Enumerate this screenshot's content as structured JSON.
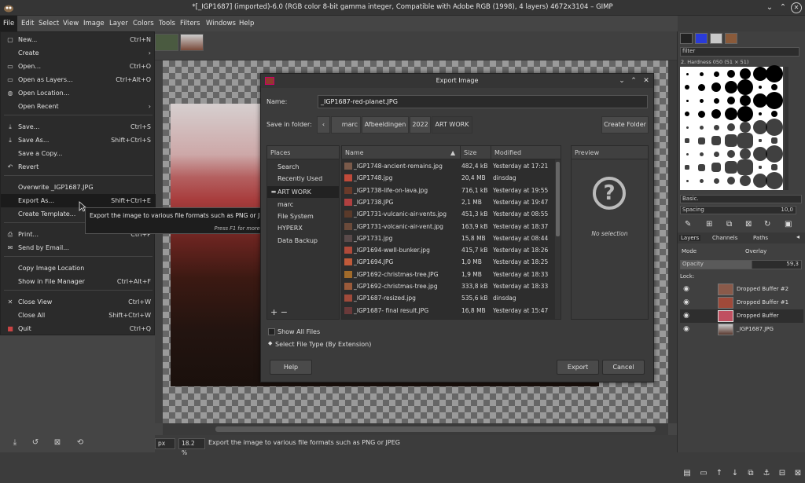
{
  "window": {
    "title": "*[_IGP1687] (imported)-6.0 (RGB color 8-bit gamma integer, Compatible with Adobe RGB (1998), 4 layers) 4672x3104 – GIMP"
  },
  "menubar": [
    "File",
    "Edit",
    "Select",
    "View",
    "Image",
    "Layer",
    "Colors",
    "Tools",
    "Filters",
    "Windows",
    "Help"
  ],
  "file_menu": {
    "new": {
      "label": "New...",
      "shortcut": "Ctrl+N"
    },
    "create": {
      "label": "Create",
      "shortcut": "›"
    },
    "open": {
      "label": "Open...",
      "shortcut": "Ctrl+O"
    },
    "open_layers": {
      "label": "Open as Layers...",
      "shortcut": "Ctrl+Alt+O"
    },
    "open_location": {
      "label": "Open Location...",
      "shortcut": ""
    },
    "open_recent": {
      "label": "Open Recent",
      "shortcut": "›"
    },
    "save": {
      "label": "Save...",
      "shortcut": "Ctrl+S"
    },
    "save_as": {
      "label": "Save As...",
      "shortcut": "Shift+Ctrl+S"
    },
    "save_copy": {
      "label": "Save a Copy...",
      "shortcut": ""
    },
    "revert": {
      "label": "Revert",
      "shortcut": ""
    },
    "overwrite": {
      "label": "Overwrite _IGP1687.JPG",
      "shortcut": ""
    },
    "export_as": {
      "label": "Export As...",
      "shortcut": "Shift+Ctrl+E"
    },
    "create_template": {
      "label": "Create Template...",
      "shortcut": ""
    },
    "print": {
      "label": "Print...",
      "shortcut": "Ctrl+P"
    },
    "send_email": {
      "label": "Send by Email...",
      "shortcut": ""
    },
    "copy_location": {
      "label": "Copy Image Location",
      "shortcut": ""
    },
    "show_manager": {
      "label": "Show in File Manager",
      "shortcut": "Ctrl+Alt+F"
    },
    "close_view": {
      "label": "Close View",
      "shortcut": "Ctrl+W"
    },
    "close_all": {
      "label": "Close All",
      "shortcut": "Shift+Ctrl+W"
    },
    "quit": {
      "label": "Quit",
      "shortcut": "Ctrl+Q"
    }
  },
  "tooltip": {
    "text": "Export the image to various file formats such as PNG or JPEG",
    "help": "Press F1 for more help"
  },
  "status": {
    "unit": "px",
    "zoom": "18.2 %",
    "message": "Export the image to various file formats such as PNG or JPEG"
  },
  "dialog": {
    "title": "Export Image",
    "name_label": "Name:",
    "name_value": "_IGP1687-red-planet.JPG",
    "folder_label": "Save in folder:",
    "breadcrumbs": [
      "marc",
      "Afbeeldingen",
      "2022",
      "ART WORK"
    ],
    "create_folder": "Create Folder",
    "places_header": "Places",
    "places": [
      {
        "icon": "search-icon",
        "label": "Search"
      },
      {
        "icon": "clock-icon",
        "label": "Recently Used"
      },
      {
        "icon": "folder-icon",
        "label": "ART WORK"
      },
      {
        "icon": "home-icon",
        "label": "marc"
      },
      {
        "icon": "drive-icon",
        "label": "File System"
      },
      {
        "icon": "drive-icon",
        "label": "HYPERX"
      },
      {
        "icon": "drive-icon",
        "label": "Data Backup"
      }
    ],
    "columns": {
      "name": "Name",
      "size": "Size",
      "modified": "Modified"
    },
    "files": [
      {
        "name": "_IGP1748-ancient-remains.jpg",
        "size": "482,4 kB",
        "modified": "Yesterday at 17:21"
      },
      {
        "name": "_IGP1748.jpg",
        "size": "20,4 MB",
        "modified": "dinsdag"
      },
      {
        "name": "_IGP1738-life-on-lava.jpg",
        "size": "716,1 kB",
        "modified": "Yesterday at 19:55"
      },
      {
        "name": "_IGP1738.JPG",
        "size": "2,1 MB",
        "modified": "Yesterday at 19:47"
      },
      {
        "name": "_IGP1731-vulcanic-air-vents.jpg",
        "size": "451,3 kB",
        "modified": "Yesterday at 08:55"
      },
      {
        "name": "_IGP1731-volcanic-air-vent.jpg",
        "size": "163,9 kB",
        "modified": "Yesterday at 18:37"
      },
      {
        "name": "_IGP1731.jpg",
        "size": "15,8 MB",
        "modified": "Yesterday at 08:44"
      },
      {
        "name": "_IGP1694-wwII-bunker.jpg",
        "size": "415,7 kB",
        "modified": "Yesterday at 18:26"
      },
      {
        "name": "_IGP1694.JPG",
        "size": "1,0 MB",
        "modified": "Yesterday at 18:25"
      },
      {
        "name": "_IGP1692-christmas-tree.JPG",
        "size": "1,9 MB",
        "modified": "Yesterday at 18:33"
      },
      {
        "name": "_IGP1692-christmas-tree.jpg",
        "size": "333,8 kB",
        "modified": "Yesterday at 18:33"
      },
      {
        "name": "_IGP1687-resized.jpg",
        "size": "535,6 kB",
        "modified": "dinsdag"
      },
      {
        "name": "_IGP1687- final result.JPG",
        "size": "16,8 MB",
        "modified": "Yesterday at 15:47"
      }
    ],
    "preview_header": "Preview",
    "preview_text": "No selection",
    "show_all": "Show All Files",
    "select_type": "Select File Type (By Extension)",
    "help": "Help",
    "export": "Export",
    "cancel": "Cancel"
  },
  "dock": {
    "filter_placeholder": "filter",
    "brush_name": "2. Hardness 050 (51 × 51)",
    "brush_set": "Basic.",
    "spacing_label": "Spacing",
    "spacing_value": "10,0",
    "tabs": [
      "Layers",
      "Channels",
      "Paths"
    ],
    "mode_label": "Mode",
    "mode_value": "Overlay",
    "opacity_label": "Opacity",
    "opacity_value": "59,3",
    "lock_label": "Lock:",
    "layers": [
      "Dropped Buffer #2",
      "Dropped Buffer #1",
      "Dropped Buffer",
      "_IGP1687.JPG"
    ]
  }
}
